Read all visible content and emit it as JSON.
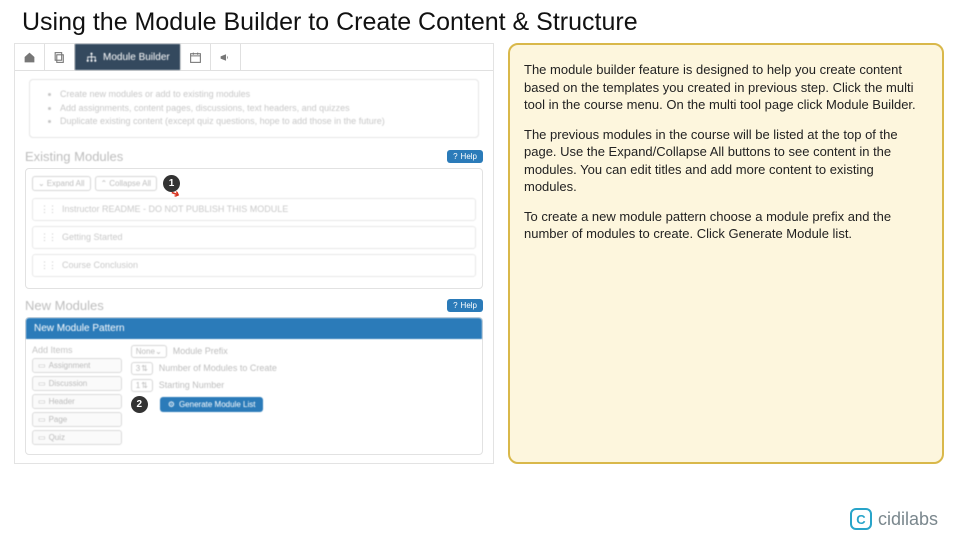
{
  "title": "Using the Module Builder to Create Content & Structure",
  "nav": {
    "active": "Module Builder"
  },
  "bullets": [
    "Create new modules or add to existing modules",
    "Add assignments, content pages, discussions, text headers, and quizzes",
    "Duplicate existing content (except quiz questions, hope to add those in the future)"
  ],
  "existing": {
    "title": "Existing Modules",
    "help": "Help",
    "expand": "Expand All",
    "collapse": "Collapse All",
    "callout1": "1",
    "modules": [
      "Instructor README - DO NOT PUBLISH THIS MODULE",
      "Getting Started",
      "Course Conclusion"
    ]
  },
  "newmod": {
    "title": "New Modules",
    "help": "Help",
    "pattern_title": "New Module Pattern",
    "items_title": "Add Items",
    "items": [
      "Assignment",
      "Discussion",
      "Header",
      "Page",
      "Quiz"
    ],
    "prefix_select": "None",
    "prefix_label": "Module Prefix",
    "count_val": "3",
    "count_label": "Number of Modules to Create",
    "start_val": "1",
    "start_label": "Starting Number",
    "callout2": "2",
    "generate": "Generate Module List"
  },
  "info": {
    "p1": "The module builder feature is designed to help you create content based on the templates you created in previous step. Click the multi tool in the course menu. On the multi tool page click Module Builder.",
    "p2": "The previous modules in the course will be listed at the top of the page. Use the Expand/Collapse All buttons to see content in the modules. You can edit titles and add more content to existing modules.",
    "p3": "To create a new module pattern choose a module prefix and the number of modules to create. Click Generate Module list."
  },
  "brand": {
    "letter": "C",
    "name": "cidilabs"
  }
}
